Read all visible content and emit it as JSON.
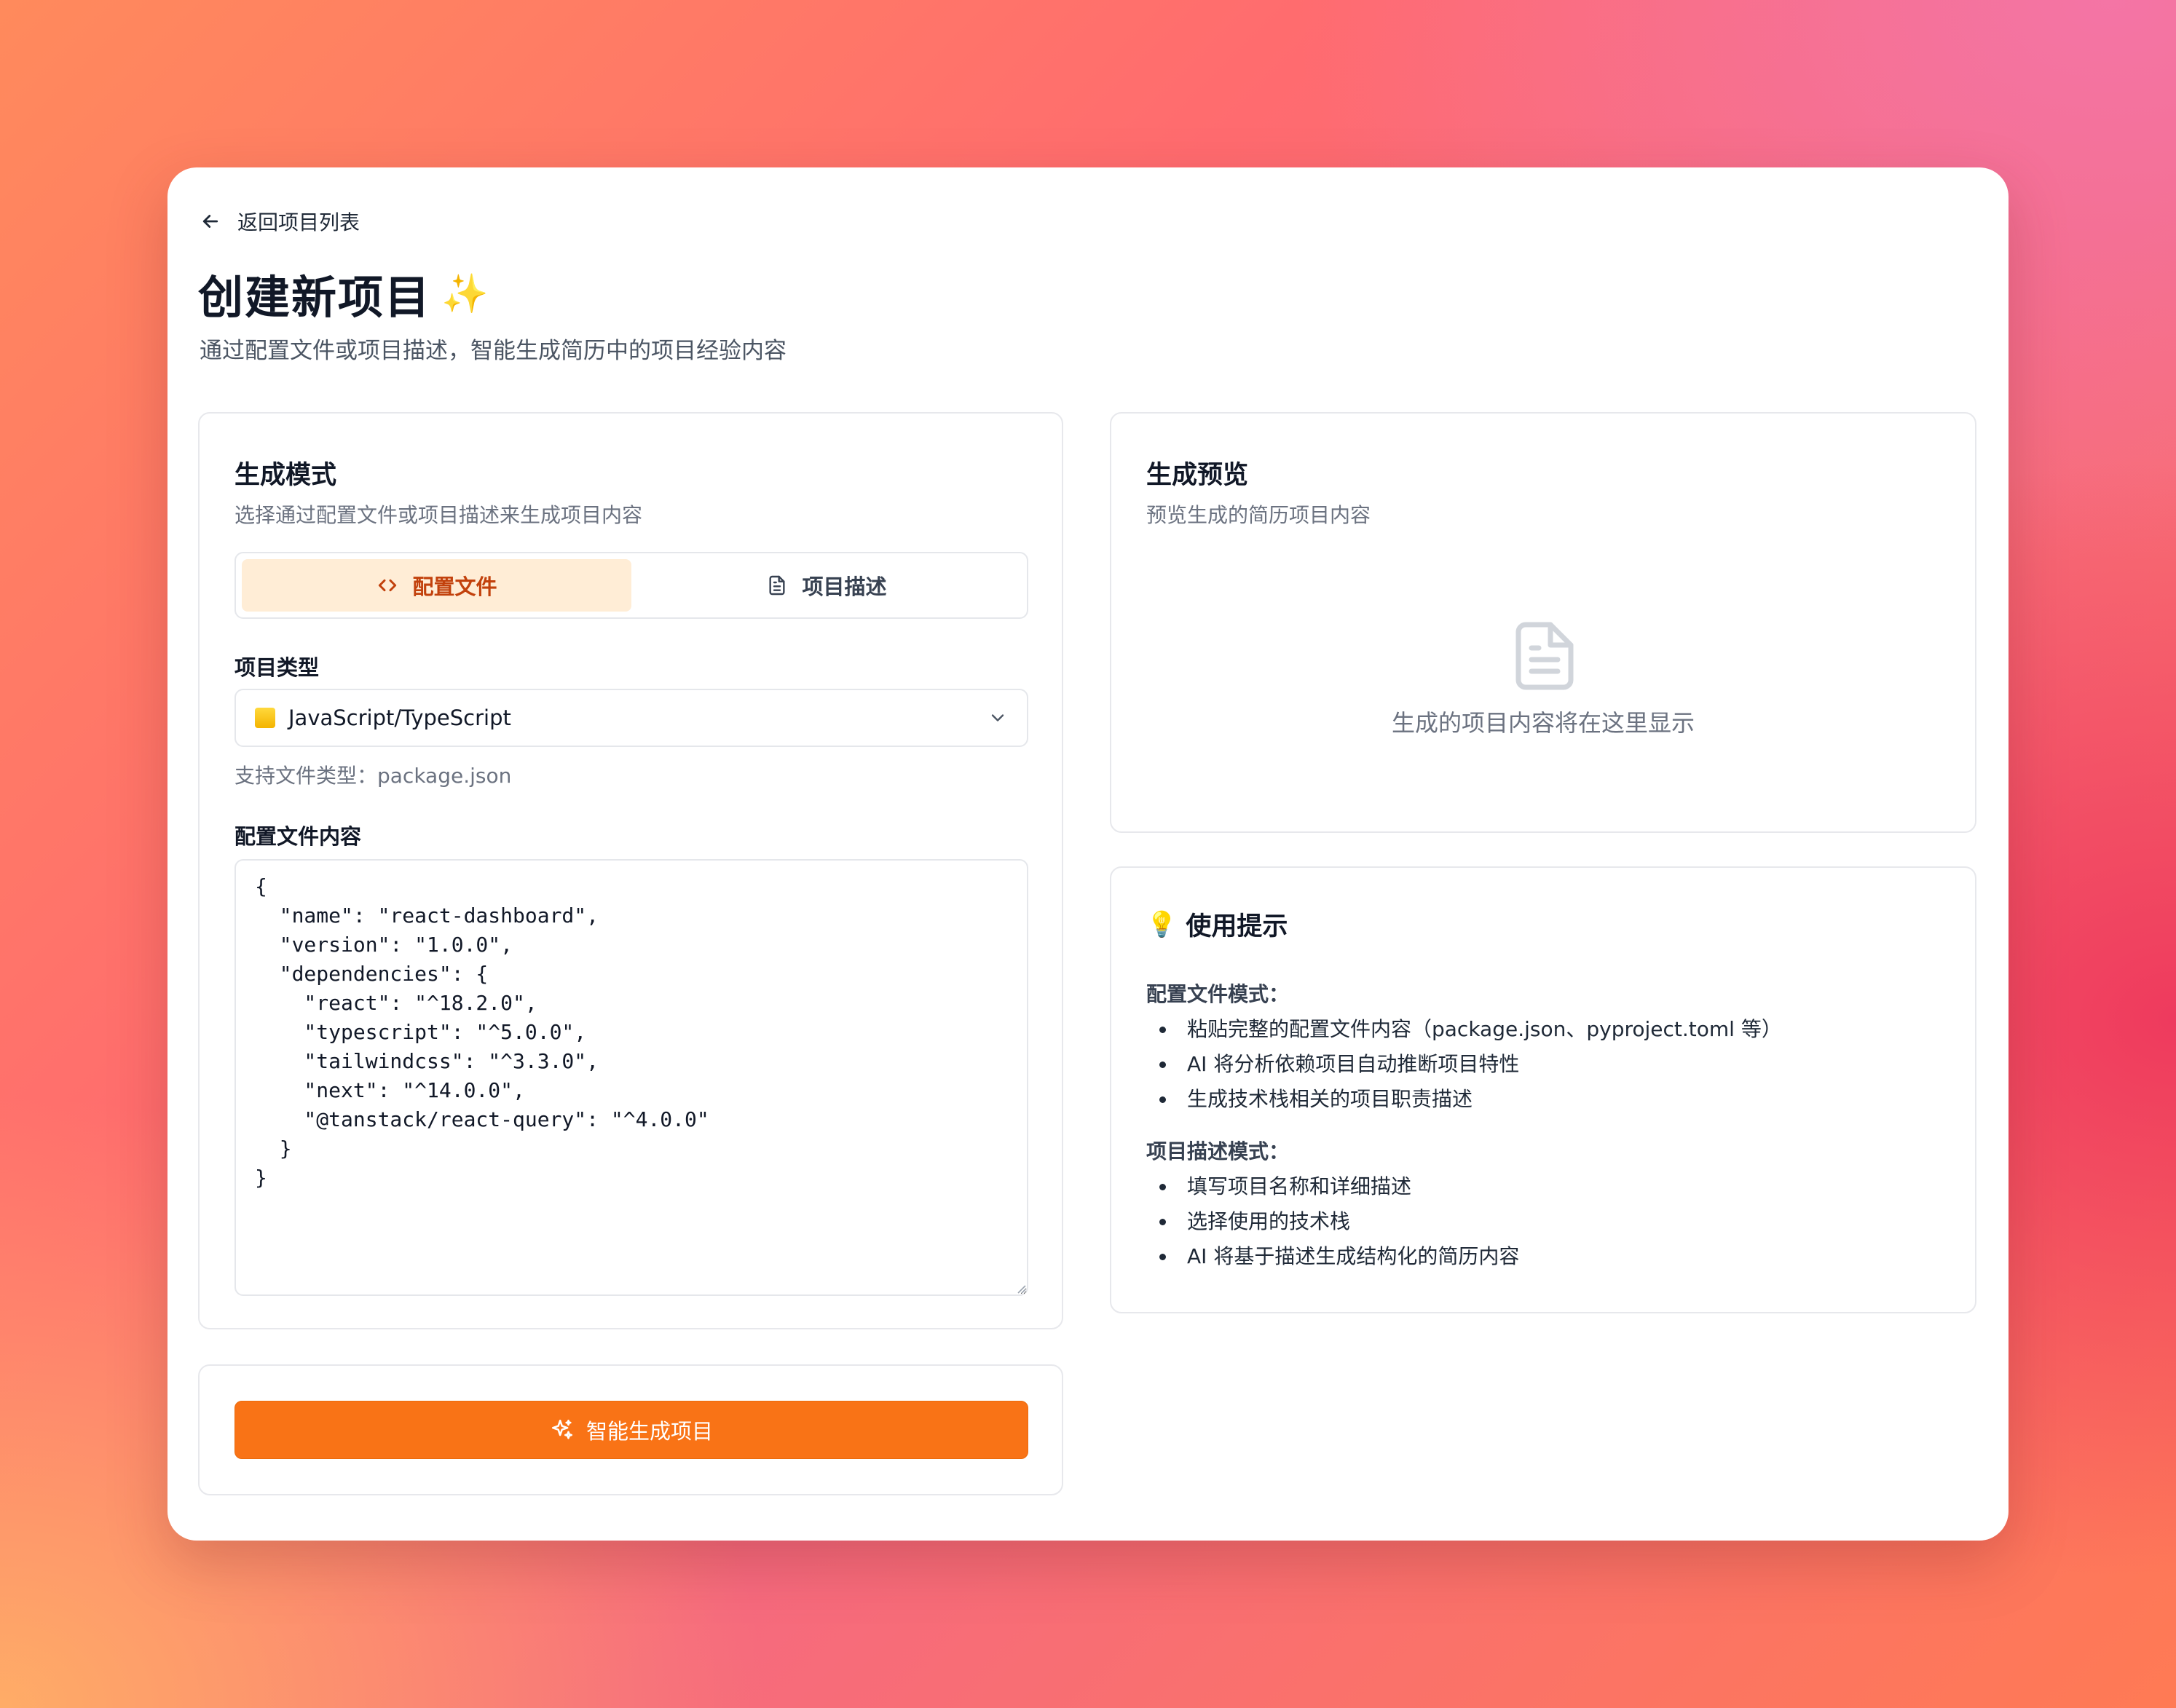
{
  "nav": {
    "back_label": "返回项目列表"
  },
  "header": {
    "title": "创建新项目",
    "title_emoji": "✨",
    "subtitle": "通过配置文件或项目描述，智能生成简历中的项目经验内容"
  },
  "mode_card": {
    "title": "生成模式",
    "description": "选择通过配置文件或项目描述来生成项目内容",
    "tabs": [
      {
        "label": "配置文件",
        "icon": "code-icon",
        "active": true
      },
      {
        "label": "项目描述",
        "icon": "document-icon",
        "active": false
      }
    ],
    "project_type_label": "项目类型",
    "project_type_value": "JavaScript/TypeScript",
    "supported_files_hint": "支持文件类型：package.json",
    "config_label": "配置文件内容",
    "config_content": "{\n  \"name\": \"react-dashboard\",\n  \"version\": \"1.0.0\",\n  \"dependencies\": {\n    \"react\": \"^18.2.0\",\n    \"typescript\": \"^5.0.0\",\n    \"tailwindcss\": \"^3.3.0\",\n    \"next\": \"^14.0.0\",\n    \"@tanstack/react-query\": \"^4.0.0\"\n  }\n}"
  },
  "action": {
    "generate_label": "智能生成项目"
  },
  "preview_card": {
    "title": "生成预览",
    "description": "预览生成的简历项目内容",
    "empty_text": "生成的项目内容将在这里显示"
  },
  "tips_card": {
    "icon": "💡",
    "title": "使用提示",
    "config_mode_heading": "配置文件模式：",
    "config_mode_items": [
      "粘贴完整的配置文件内容（package.json、pyproject.toml 等）",
      "AI 将分析依赖项目自动推断项目特性",
      "生成技术栈相关的项目职责描述"
    ],
    "desc_mode_heading": "项目描述模式：",
    "desc_mode_items": [
      "填写项目名称和详细描述",
      "选择使用的技术栈",
      "AI 将基于描述生成结构化的简历内容"
    ]
  },
  "colors": {
    "accent": "#f97316",
    "tab_active_bg": "#ffedd6",
    "tab_active_text": "#c2410c"
  }
}
